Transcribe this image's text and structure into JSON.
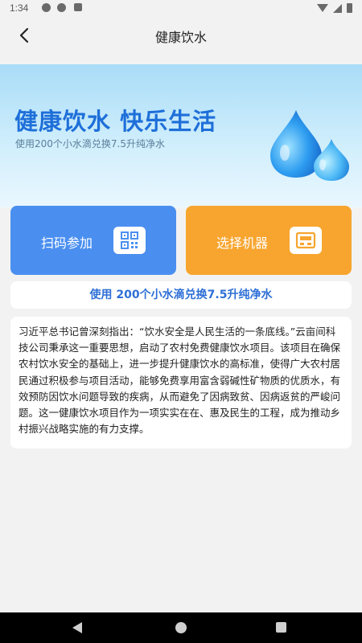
{
  "status_bar": {
    "time": "1:34",
    "left_icons": [
      "settings-icon",
      "shield-icon",
      "storage-icon"
    ],
    "right_icons": [
      "wifi-icon",
      "signal-icon",
      "battery-icon"
    ]
  },
  "app_bar": {
    "title": "健康饮水",
    "back_icon": "chevron-left-icon"
  },
  "banner": {
    "title": "健康饮水 快乐生活",
    "subtitle": "使用200个小水滴兑换7.5升纯净水",
    "image": "water-drops"
  },
  "actions": {
    "scan": {
      "label": "扫码参加",
      "icon": "qr-code-icon"
    },
    "machine": {
      "label": "选择机器",
      "icon": "machine-card-icon"
    }
  },
  "exchange": {
    "text": "使用 200个小水滴兑换7.5升纯净水"
  },
  "description": {
    "text": "习近平总书记曾深刻指出：“饮水安全是人民生活的一条底线。”云亩间科技公司秉承这一重要思想，启动了农村免费健康饮水项目。该项目在确保农村饮水安全的基础上，进一步提升健康饮水的高标准，使得广大农村居民通过积极参与项目活动，能够免费享用富含弱碱性矿物质的优质水，有效预防因饮水问题导致的疾病，从而避免了因病致贫、因病返贫的严峻问题。这一健康饮水项目作为一项实实在在、惠及民生的工程，成为推动乡村振兴战略实施的有力支撑。"
  },
  "colors": {
    "primary_blue": "#4a8ff0",
    "accent_orange": "#f7a52e",
    "title_blue": "#1e6fd9",
    "background": "#f2f2f2"
  },
  "nav_bar": {
    "icons": [
      "nav-back-icon",
      "nav-home-icon",
      "nav-recent-icon"
    ]
  }
}
